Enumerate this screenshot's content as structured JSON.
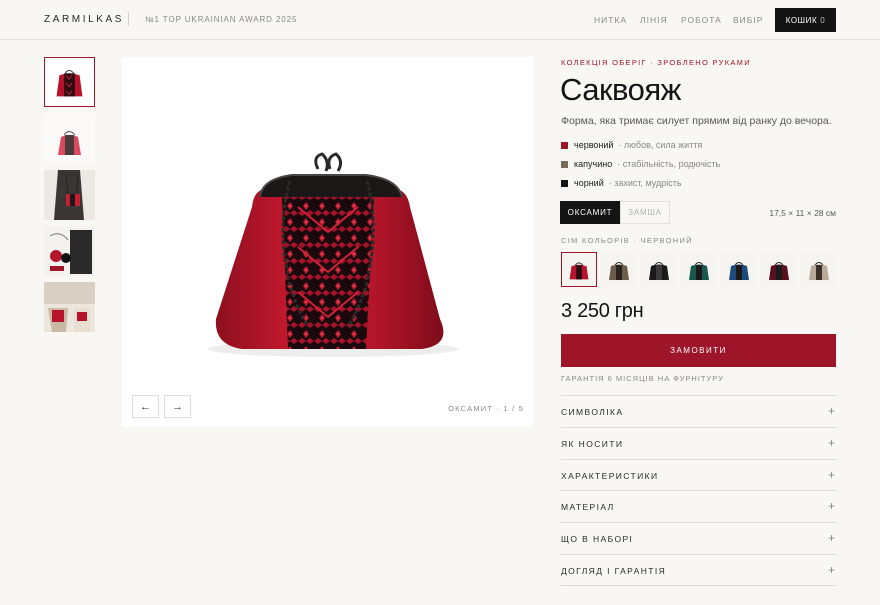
{
  "header": {
    "logo": "ZARMILKAS",
    "award": "№1 TOP UKRAINIAN AWARD 2025",
    "nav": [
      "НИТКА",
      "ЛІНІЯ",
      "РОБОТА",
      "ВИБІР"
    ],
    "cart_label": "КОШИК",
    "cart_count": "0"
  },
  "gallery": {
    "caption": "ОКСАМИТ · 1 / 5",
    "prev_icon": "arrow-left-icon",
    "next_icon": "arrow-right-icon"
  },
  "product": {
    "eyebrow": "КОЛЕКЦІЯ ОБЕРІГ · ЗРОБЛЕНО РУКАМИ",
    "title": "Саквояж",
    "lead": "Форма, яка тримає силует прямим від ранку до вечора.",
    "symbols": [
      {
        "name": "червоний",
        "desc": "· любов, сила життя",
        "color": "#9e1428"
      },
      {
        "name": "капучино",
        "desc": "· стабільність, родючість",
        "color": "#7a6a5a"
      },
      {
        "name": "чорний",
        "desc": "· захист, мудрість",
        "color": "#141414"
      }
    ],
    "materials": [
      "ОКСАМИТ",
      "ЗАМША"
    ],
    "dimensions": "17,5 × 11 × 28 см",
    "colors_label": "СІМ КОЛЬОРІВ · ЧЕРВОНИЙ",
    "swatches": [
      "#b5142c",
      "#6e5d4d",
      "#1a1a1a",
      "#17594a",
      "#1e4a7a",
      "#5a0f1f",
      "#b8aa98"
    ],
    "price": "3 250 грн",
    "order_label": "ЗАМОВИТИ",
    "guarantee": "ГАРАНТІЯ 6 МІСЯЦІВ НА ФУРНІТУРУ"
  },
  "accordion": [
    "СИМВОЛІКА",
    "ЯК НОСИТИ",
    "ХАРАКТЕРИСТИКИ",
    "МАТЕРІАЛ",
    "ЩО В НАБОРІ",
    "ДОГЛЯД І ГАРАНТІЯ"
  ],
  "colors": {
    "accent": "#9e1428",
    "dark": "#141414"
  }
}
